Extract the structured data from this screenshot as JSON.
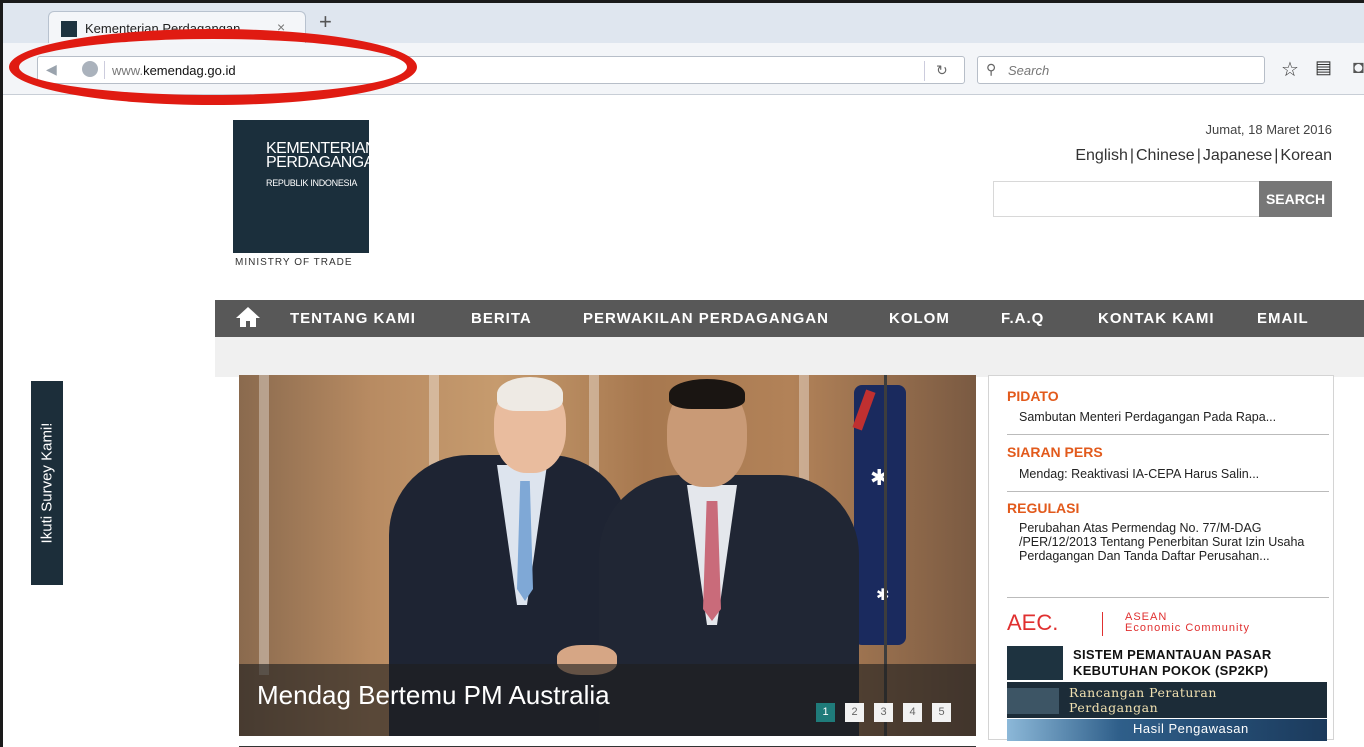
{
  "browser": {
    "tab_title": "Kementerian Perdagangan",
    "tab_close": "×",
    "new_tab": "+",
    "url_prefix": "www.",
    "url_domain": "kemendag.go.id",
    "search_placeholder": "Search"
  },
  "survey": {
    "label": "Ikuti Survey Kami!"
  },
  "logo": {
    "line1": "KEMENTERIAN",
    "line2": "PERDAGANGAN",
    "line3": "REPUBLIK INDONESIA",
    "subtitle": "MINISTRY OF TRADE"
  },
  "header": {
    "date": "Jumat, 18 Maret 2016",
    "languages": [
      "English",
      "Chinese",
      "Japanese",
      "Korean"
    ],
    "search_button": "SEARCH"
  },
  "menu": {
    "items": [
      "TENTANG KAMI",
      "BERITA",
      "PERWAKILAN PERDAGANGAN",
      "KOLOM",
      "F.A.Q",
      "KONTAK KAMI",
      "EMAIL"
    ]
  },
  "slider": {
    "caption": "Mendag Bertemu PM Australia",
    "pages": [
      "1",
      "2",
      "3",
      "4",
      "5"
    ],
    "active_page": "1"
  },
  "sidebar": {
    "sections": [
      {
        "heading": "PIDATO",
        "text": "Sambutan Menteri Perdagangan Pada Rapa..."
      },
      {
        "heading": "SIARAN PERS",
        "text": "Mendag: Reaktivasi IA-CEPA Harus Salin..."
      },
      {
        "heading": "REGULASI",
        "text": "Perubahan Atas Permendag No. 77/M-DAG /PER/12/2013 Tentang Penerbitan Surat Izin Usaha Perdagangan Dan Tanda Daftar Perusahan..."
      }
    ],
    "aec_logo": "AEC.",
    "aec_line1": "ASEAN",
    "aec_line2": "Economic Community",
    "banner1_line1": "SISTEM PEMANTAUAN PASAR",
    "banner1_line2": "KEBUTUHAN POKOK (SP2KP)",
    "banner2_line1": "Rancangan Peraturan",
    "banner2_line2": "Perdagangan",
    "banner3": "Hasil Pengawasan"
  },
  "colors": {
    "accent_orange": "#e25a1c",
    "menu_bg": "#585858",
    "logo_bg": "#1b2f3c",
    "slider_active": "#1f7b7a",
    "annotation_red": "#e01b12"
  }
}
